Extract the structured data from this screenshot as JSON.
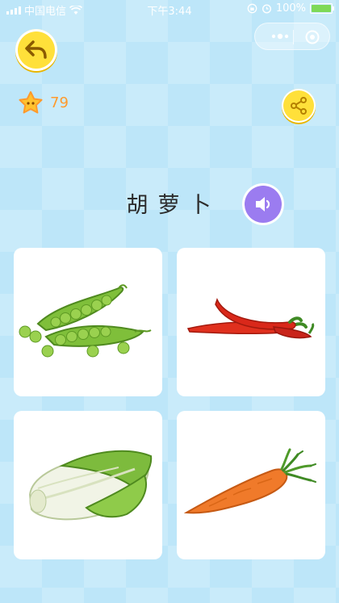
{
  "status_bar": {
    "carrier": "中国电信",
    "time": "下午3:44",
    "battery_text": "100%",
    "battery_level": 1.0
  },
  "score": {
    "stars": "79"
  },
  "question": {
    "word": "胡萝卜"
  },
  "options": [
    {
      "name": "peas",
      "icon": "peas-icon"
    },
    {
      "name": "chili-peppers",
      "icon": "chili-peppers-icon"
    },
    {
      "name": "napa-cabbage",
      "icon": "napa-cabbage-icon"
    },
    {
      "name": "carrot",
      "icon": "carrot-icon"
    }
  ],
  "colors": {
    "button_yellow": "#ffe03a",
    "audio_purple": "#9b7cf0",
    "star_orange": "#ff9a2c",
    "background": "#bde6f9"
  }
}
